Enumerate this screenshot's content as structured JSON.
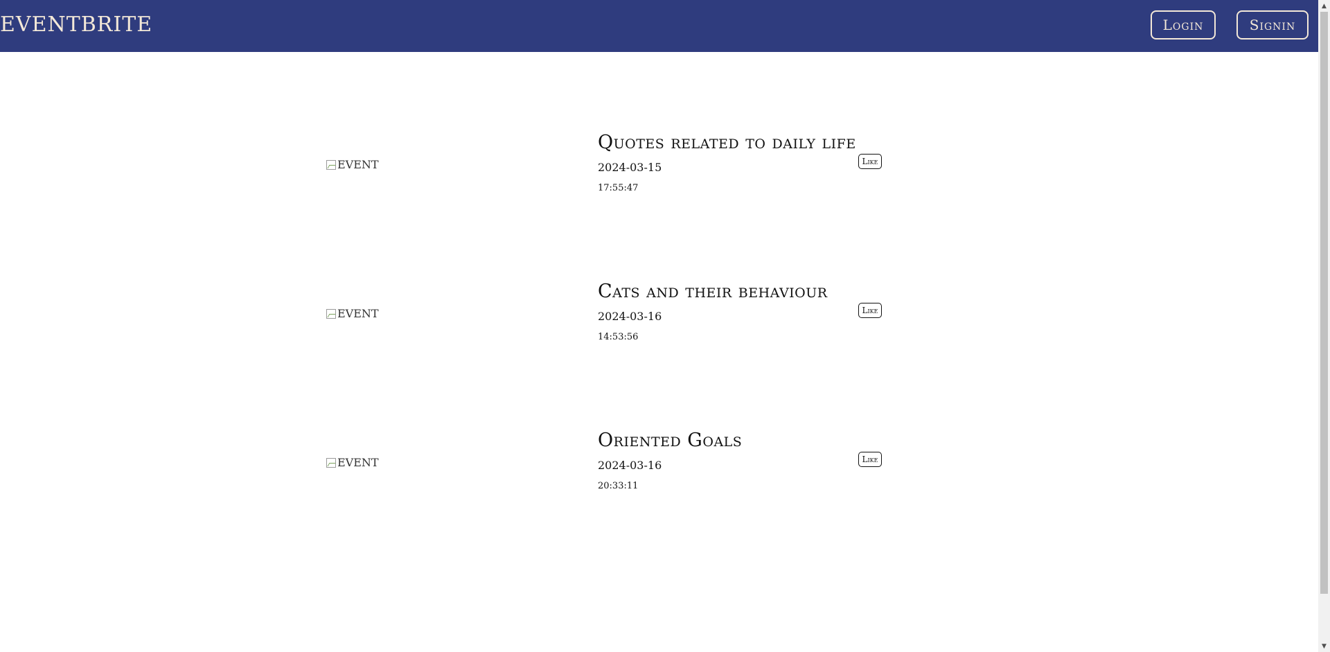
{
  "header": {
    "brand": "EVENTBRITE",
    "login_label": "Login",
    "signin_label": "Signin"
  },
  "events": [
    {
      "image_alt": "EVENT",
      "title": "Quotes related to daily life",
      "date": "2024-03-15",
      "time": "17:55:47",
      "like_label": "Like"
    },
    {
      "image_alt": "EVENT",
      "title": "Cats and their behaviour",
      "date": "2024-03-16",
      "time": "14:53:56",
      "like_label": "Like"
    },
    {
      "image_alt": "EVENT",
      "title": "Oriented Goals",
      "date": "2024-03-16",
      "time": "20:33:11",
      "like_label": "Like"
    }
  ],
  "colors": {
    "navbar": "#2f3c7e",
    "navbar_text": "#f4e9d8",
    "background": "#ffffff"
  },
  "icons": {
    "broken_image": "broken-image-icon",
    "scroll_up": "scroll-up-arrow-icon",
    "scroll_down": "scroll-down-arrow-icon"
  }
}
